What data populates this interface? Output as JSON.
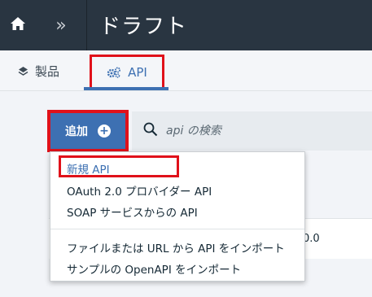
{
  "topbar": {
    "title": "ドラフト",
    "home_icon": "home-icon",
    "expand_icon": "double-chevron-right-icon",
    "expand_glyph": "»"
  },
  "tabs": [
    {
      "label": "製品",
      "icon": "layers-icon"
    },
    {
      "label": "API",
      "icon": "gears-icon"
    }
  ],
  "toolbar": {
    "add_label": "追加",
    "add_icon": "plus-circle-icon",
    "add_glyph": "+",
    "search_placeholder": "api の検索",
    "search_icon": "search-icon"
  },
  "background_row": {
    "trailing_text": "0.0"
  },
  "dropdown": {
    "items": [
      "新規 API",
      "OAuth 2.0 プロバイダー API",
      "SOAP サービスからの API",
      "ファイルまたは URL から API をインポート",
      "サンプルの OpenAPI をインポート"
    ]
  },
  "colors": {
    "topbar_bg": "#293541",
    "accent_blue": "#3d70b2",
    "highlight_red": "#e0111a"
  }
}
